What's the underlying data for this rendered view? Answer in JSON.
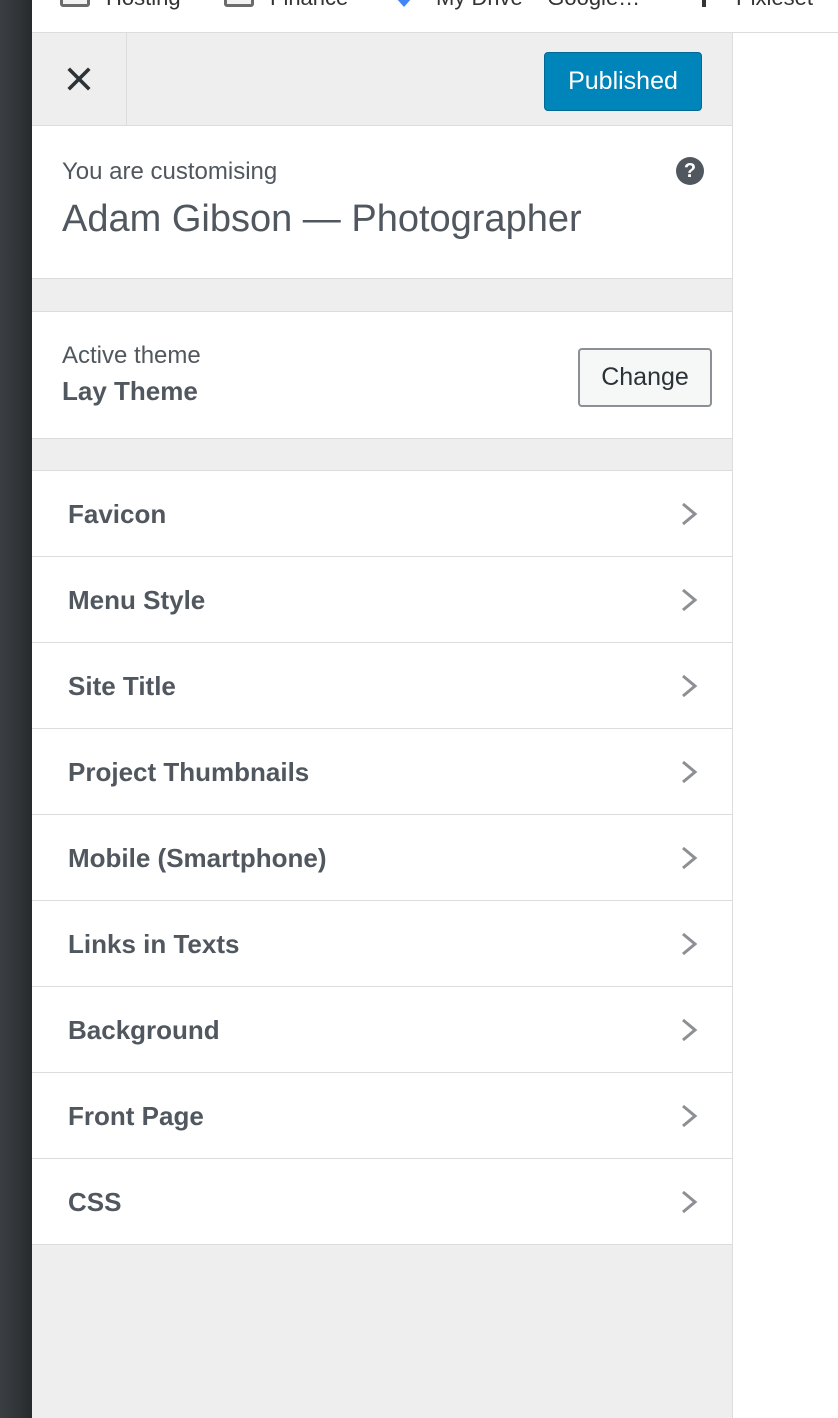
{
  "bookmarks": [
    {
      "label": "Hosting",
      "icon": "folder-icon"
    },
    {
      "label": "Finance",
      "icon": "folder-icon"
    },
    {
      "label": "My Drive – Google…",
      "icon": "google-drive-icon"
    },
    {
      "label": "Pixieset",
      "icon": "pixieset-icon"
    }
  ],
  "header": {
    "close_icon": "close-icon",
    "publish_label": "Published",
    "publish_color": "#0085ba"
  },
  "info": {
    "customising_label": "You are customising",
    "site_name": "Adam Gibson — Photographer",
    "help_icon": "?"
  },
  "theme": {
    "active_label": "Active theme",
    "name": "Lay Theme",
    "change_label": "Change"
  },
  "sections": [
    {
      "label": "Favicon"
    },
    {
      "label": "Menu Style"
    },
    {
      "label": "Site Title"
    },
    {
      "label": "Project Thumbnails"
    },
    {
      "label": "Mobile (Smartphone)"
    },
    {
      "label": "Links in Texts"
    },
    {
      "label": "Background"
    },
    {
      "label": "Front Page"
    },
    {
      "label": "CSS"
    }
  ]
}
